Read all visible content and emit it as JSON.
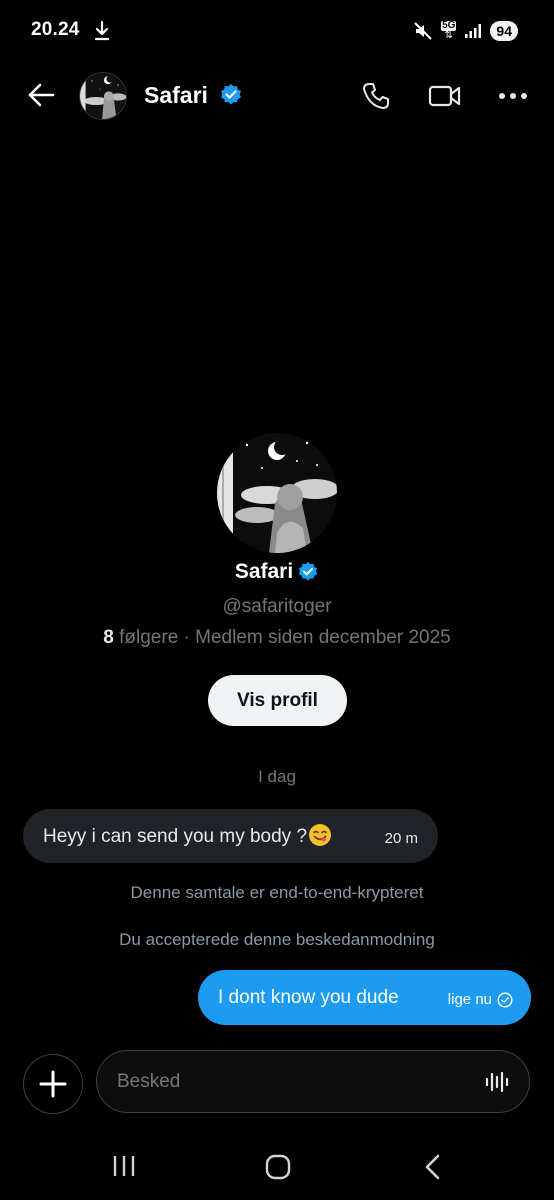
{
  "status_bar": {
    "time": "20.24",
    "network": "5G",
    "battery": "94"
  },
  "header": {
    "back_icon": "arrow-left-icon",
    "name": "Safari",
    "verified_icon": "verified-badge-icon",
    "actions": [
      "phone-icon",
      "video-camera-icon",
      "more-icon"
    ]
  },
  "profile": {
    "name": "Safari",
    "handle": "@safaritoger",
    "followers_count": "8",
    "followers_rest": " følgere · Medlem siden december 2025",
    "view_profile_label": "Vis profil"
  },
  "conversation": {
    "date_separator": "I dag",
    "messages": [
      {
        "direction": "in",
        "text": "Heyy i can send you my body ?",
        "emoji": "face-savoring-food-emoji",
        "time": "20 m"
      },
      {
        "direction": "out",
        "text": "I dont know you dude",
        "time": "lige nu",
        "status_icon": "check-circle-icon"
      }
    ],
    "encryption_note": "Denne samtale er end-to-end-krypteret",
    "accepted_note": "Du accepterede denne beskedanmodning"
  },
  "composer": {
    "placeholder": "Besked",
    "add_icon": "plus-icon",
    "voice_icon": "voice-wave-icon"
  },
  "nav_bar": {
    "items": [
      "recent-apps-icon",
      "home-icon",
      "back-icon"
    ]
  },
  "colors": {
    "background": "#000000",
    "accent": "#1d9bf0",
    "incoming_bubble": "#202327",
    "muted_text": "#71767b"
  }
}
